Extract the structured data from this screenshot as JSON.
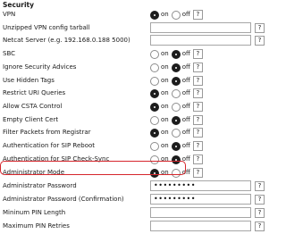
{
  "section": {
    "title": "Security"
  },
  "labels": {
    "on": "on",
    "off": "off",
    "help": "?"
  },
  "rows": [
    {
      "label": "VPN",
      "type": "toggle",
      "value": "on"
    },
    {
      "label": "Unzipped VPN config tarball",
      "type": "text",
      "value": ""
    },
    {
      "label": "Netcat Server (e.g. 192.168.0.188 5000)",
      "type": "text",
      "value": ""
    },
    {
      "label": "SBC",
      "type": "toggle",
      "value": "off"
    },
    {
      "label": "Ignore Security Advices",
      "type": "toggle",
      "value": "off"
    },
    {
      "label": "Use Hidden Tags",
      "type": "toggle",
      "value": "off"
    },
    {
      "label": "Restrict URI Queries",
      "type": "toggle",
      "value": "on"
    },
    {
      "label": "Allow CSTA Control",
      "type": "toggle",
      "value": "on"
    },
    {
      "label": "Empty Client Cert",
      "type": "toggle",
      "value": "off"
    },
    {
      "label": "Filter Packets from Registrar",
      "type": "toggle",
      "value": "on"
    },
    {
      "label": "Authentication for SIP Reboot",
      "type": "toggle",
      "value": "off"
    },
    {
      "label": "Authentication for SIP Check-Sync",
      "type": "toggle",
      "value": "off"
    },
    {
      "label": "Administrator Mode",
      "type": "toggle",
      "value": "on",
      "highlighted": true
    },
    {
      "label": "Administrator Password",
      "type": "password",
      "value": "•••••••••"
    },
    {
      "label": "Administrator Password (Confirmation)",
      "type": "password",
      "value": "•••••••••"
    },
    {
      "label": "Mininum PIN Length",
      "type": "text",
      "value": ""
    },
    {
      "label": "Maximum PIN Retries",
      "type": "text",
      "value": ""
    }
  ],
  "colors": {
    "highlight": "#d6262c"
  }
}
